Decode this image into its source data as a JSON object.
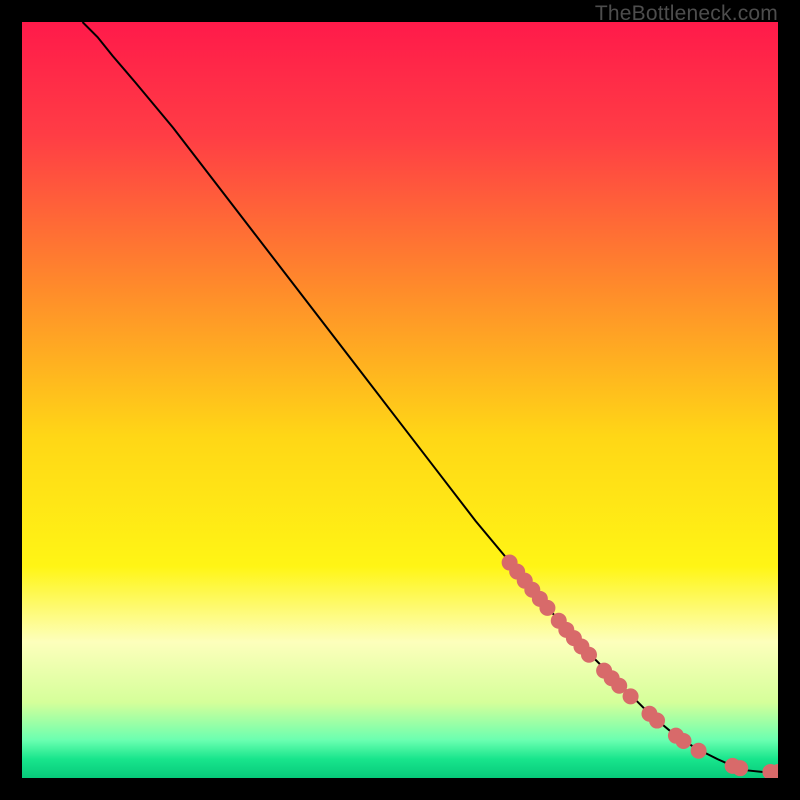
{
  "watermark": "TheBottleneck.com",
  "chart_data": {
    "type": "line",
    "title": "",
    "xlabel": "",
    "ylabel": "",
    "xlim": [
      0,
      100
    ],
    "ylim": [
      0,
      100
    ],
    "grid": false,
    "background_gradient_stops": [
      {
        "offset": 0.0,
        "color": "#ff1a4a"
      },
      {
        "offset": 0.15,
        "color": "#ff3d45"
      },
      {
        "offset": 0.35,
        "color": "#ff8a2b"
      },
      {
        "offset": 0.55,
        "color": "#ffd716"
      },
      {
        "offset": 0.72,
        "color": "#fff515"
      },
      {
        "offset": 0.82,
        "color": "#fdffbc"
      },
      {
        "offset": 0.9,
        "color": "#d5ff9a"
      },
      {
        "offset": 0.95,
        "color": "#6affb0"
      },
      {
        "offset": 0.975,
        "color": "#18e58c"
      },
      {
        "offset": 1.0,
        "color": "#07c97a"
      }
    ],
    "curve": {
      "name": "bottleneck-curve",
      "color": "#000000",
      "width": 2,
      "x": [
        8,
        10,
        12,
        15,
        20,
        25,
        30,
        35,
        40,
        45,
        50,
        55,
        60,
        65,
        70,
        75,
        80,
        83,
        86,
        89,
        92,
        94,
        96,
        98,
        100
      ],
      "y": [
        100,
        98,
        95.5,
        92,
        86,
        79.5,
        73,
        66.5,
        60,
        53.5,
        47,
        40.5,
        34,
        28,
        22,
        16.5,
        11.5,
        8.5,
        6,
        4,
        2.5,
        1.6,
        1.0,
        0.8,
        0.8
      ]
    },
    "marker_clusters": {
      "color": "#d86a6a",
      "radius": 8,
      "points": [
        {
          "x": 64.5,
          "y": 28.5
        },
        {
          "x": 65.5,
          "y": 27.3
        },
        {
          "x": 66.5,
          "y": 26.1
        },
        {
          "x": 67.5,
          "y": 24.9
        },
        {
          "x": 68.5,
          "y": 23.7
        },
        {
          "x": 69.5,
          "y": 22.5
        },
        {
          "x": 71.0,
          "y": 20.8
        },
        {
          "x": 72.0,
          "y": 19.6
        },
        {
          "x": 73.0,
          "y": 18.5
        },
        {
          "x": 74.0,
          "y": 17.4
        },
        {
          "x": 75.0,
          "y": 16.3
        },
        {
          "x": 77.0,
          "y": 14.2
        },
        {
          "x": 78.0,
          "y": 13.2
        },
        {
          "x": 79.0,
          "y": 12.2
        },
        {
          "x": 80.5,
          "y": 10.8
        },
        {
          "x": 83.0,
          "y": 8.5
        },
        {
          "x": 84.0,
          "y": 7.6
        },
        {
          "x": 86.5,
          "y": 5.6
        },
        {
          "x": 87.5,
          "y": 4.9
        },
        {
          "x": 89.5,
          "y": 3.6
        },
        {
          "x": 94.0,
          "y": 1.6
        },
        {
          "x": 95.0,
          "y": 1.3
        },
        {
          "x": 99.0,
          "y": 0.8
        },
        {
          "x": 100.0,
          "y": 0.8
        }
      ]
    }
  }
}
